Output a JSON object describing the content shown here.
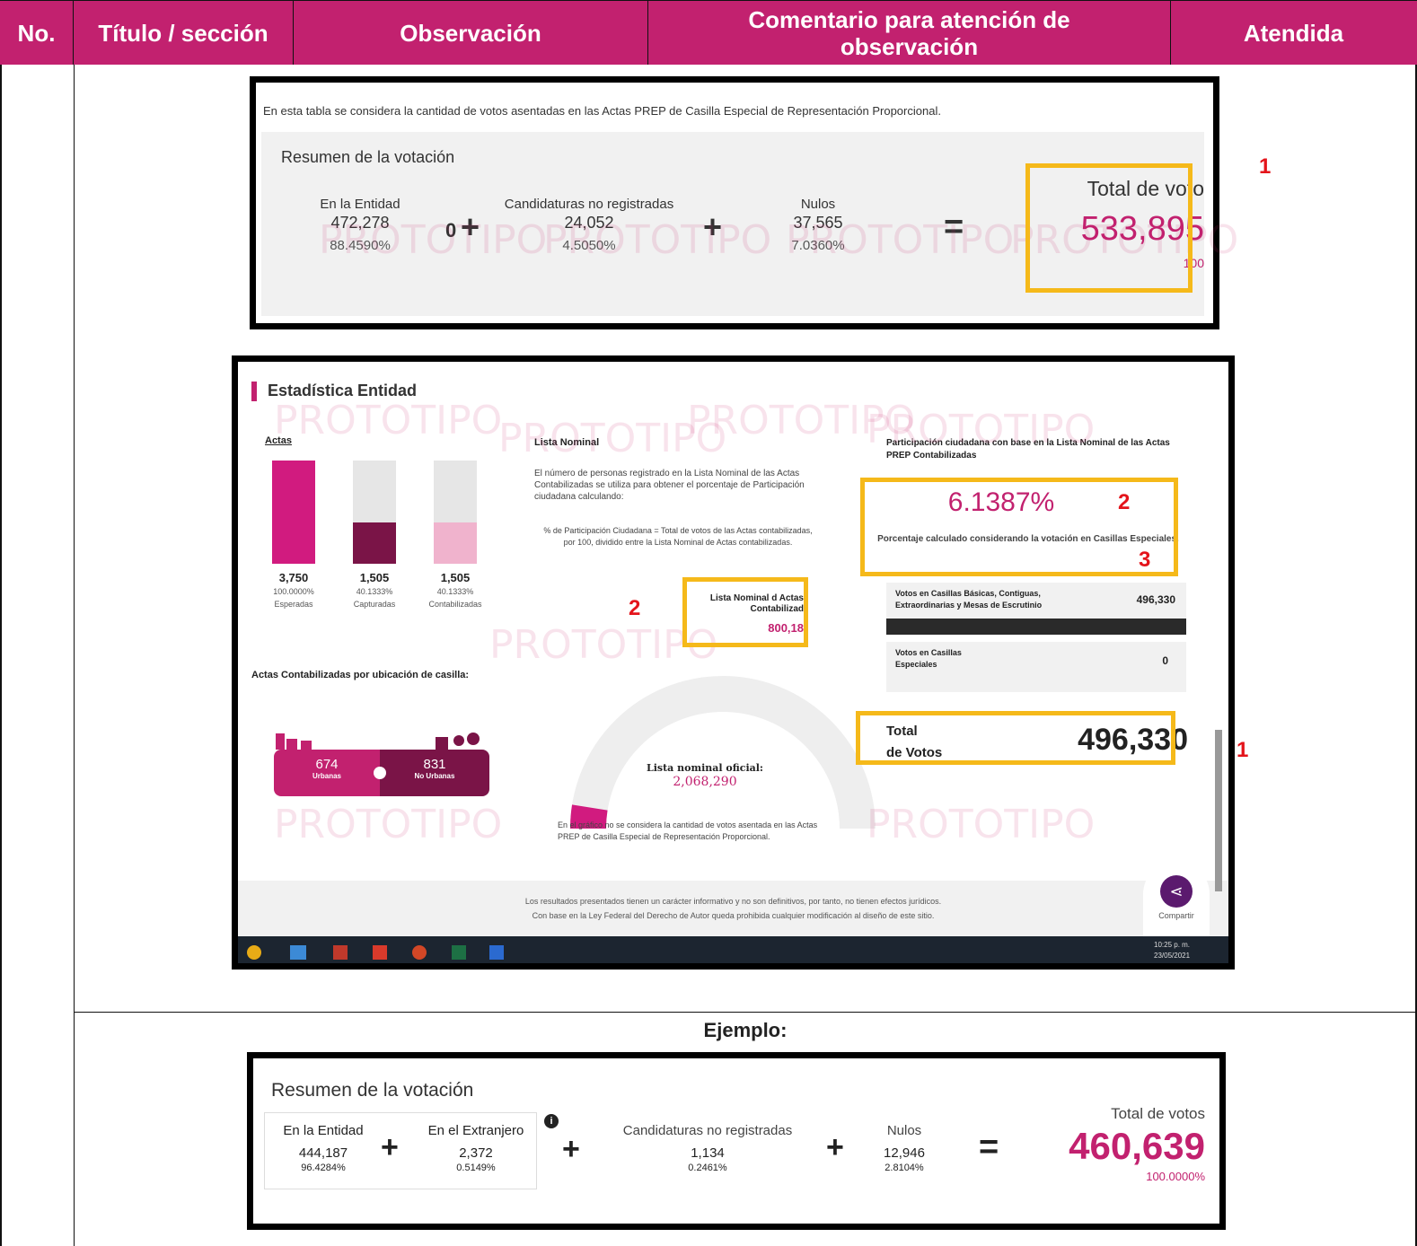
{
  "header": {
    "no": "No.",
    "titulo": "Título / sección",
    "observacion": "Observación",
    "comentario": "Comentario para atención de observación",
    "atendida": "Atendida"
  },
  "markers": {
    "m1": "1",
    "m2": "2",
    "m3": "3"
  },
  "shot1": {
    "intro": "En esta tabla se considera la cantidad de votos asentadas en las Actas PREP de Casilla Especial de Representación Proporcional.",
    "title": "Resumen de la votación",
    "entidad": {
      "label": "En la Entidad",
      "value": "472,278",
      "pct": "88.4590%"
    },
    "info": "0",
    "candidaturas": {
      "label": "Candidaturas no registradas",
      "value": "24,052",
      "pct": "4.5050%"
    },
    "nulos": {
      "label": "Nulos",
      "value": "37,565",
      "pct": "7.0360%"
    },
    "total": {
      "label": "Total de voto",
      "value": "533,895",
      "pct": "100"
    },
    "plus": "+",
    "equals": "="
  },
  "shot2": {
    "title": "Estadística Entidad",
    "actas": {
      "label": "Actas",
      "bars": [
        {
          "value": "3,750",
          "pct": "100.0000%",
          "label": "Esperadas",
          "fill": 1.0,
          "color": "#d11b7f"
        },
        {
          "value": "1,505",
          "pct": "40.1333%",
          "label": "Capturadas",
          "fill": 0.401333,
          "color": "#7a1447"
        },
        {
          "value": "1,505",
          "pct": "40.1333%",
          "label": "Contabilizadas",
          "fill": 0.401333,
          "color": "#f0b3cd"
        }
      ]
    },
    "lista": {
      "title": "Lista Nominal",
      "bold": "número de personas",
      "text": "El número de personas registrado en la Lista Nominal de las Actas Contabilizadas se utiliza para obtener el porcentaje de Participación ciudadana calculando:",
      "formula": "% de Participación Ciudadana = Total de votos de las Actas contabilizadas, por 100, dividido entre la Lista Nominal de Actas contabilizadas.",
      "box_label": "Lista Nominal d Actas Contabilizad",
      "box_value": "800,18"
    },
    "participacion": {
      "title": "Participación ciudadana con base en la Lista Nominal de las Actas PREP Contabilizadas",
      "pct": "6.1387%",
      "note": "Porcentaje calculado considerando la votación en Casillas Especiales."
    },
    "votos_basicas": {
      "label": "Votos en Casillas Básicas, Contiguas, Extraordinarias y Mesas de Escrutinio",
      "value": "496,330"
    },
    "votos_especiales": {
      "label": "Votos en Casillas Especiales",
      "value": "0"
    },
    "total": {
      "label1": "Total",
      "label2": "de Votos",
      "value": "496,330"
    },
    "ubicacion": {
      "title": "Actas Contabilizadas por ubicación de casilla:",
      "urbanas": "674",
      "urbanas_label": "Urbanas",
      "no_urbanas": "831",
      "no_urbanas_label": "No Urbanas"
    },
    "gauge": {
      "label": "Lista nominal oficial:",
      "value": "2,068,290",
      "fill": 0.05
    },
    "grafico_note": "En el gráfico no se considera la cantidad de votos asentada en las Actas PREP de Casilla Especial de Representación Proporcional.",
    "footer1": "Los resultados presentados tienen un carácter informativo y no son definitivos, por tanto, no tienen efectos jurídicos.",
    "footer2": "Con base en la Ley Federal del Derecho de Autor queda prohibida cualquier modificación al diseño de este sitio.",
    "share": "Compartir",
    "watermark": "PROTOTIPO",
    "clock": "10:25 p. m.",
    "date": "23/05/2021"
  },
  "ejemplo": {
    "label": "Ejemplo:",
    "title": "Resumen de la votación",
    "entidad": {
      "label": "En la Entidad",
      "value": "444,187",
      "pct": "96.4284%"
    },
    "extranjero": {
      "label": "En el Extranjero",
      "value": "2,372",
      "pct": "0.5149%"
    },
    "candidaturas": {
      "label": "Candidaturas no registradas",
      "value": "1,134",
      "pct": "0.2461%"
    },
    "nulos": {
      "label": "Nulos",
      "value": "12,946",
      "pct": "2.8104%"
    },
    "total": {
      "label": "Total de votos",
      "value": "460,639",
      "pct": "100.0000%"
    }
  },
  "colors": {
    "header": "#c2216f",
    "accent": "#c2216f",
    "highlight": "#f5b91a",
    "marker": "#e4141b"
  }
}
